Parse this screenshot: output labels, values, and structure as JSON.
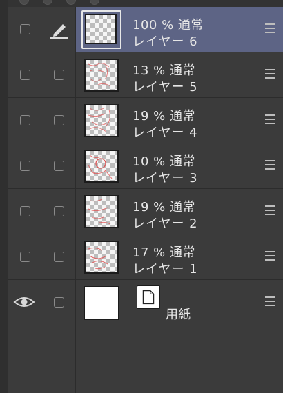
{
  "panel": {
    "layers": [
      {
        "opacity": "100 %",
        "blend": "通常",
        "name": "レイヤー 6",
        "active": true,
        "visible": false,
        "locked_icon": "pen-icon"
      },
      {
        "opacity": "13 %",
        "blend": "通常",
        "name": "レイヤー 5",
        "active": false,
        "visible": false
      },
      {
        "opacity": "19 %",
        "blend": "通常",
        "name": "レイヤー 4",
        "active": false,
        "visible": false
      },
      {
        "opacity": "10 %",
        "blend": "通常",
        "name": "レイヤー 3",
        "active": false,
        "visible": false
      },
      {
        "opacity": "19 %",
        "blend": "通常",
        "name": "レイヤー 2",
        "active": false,
        "visible": false
      },
      {
        "opacity": "17 %",
        "blend": "通常",
        "name": "レイヤー 1",
        "active": false,
        "visible": false
      }
    ],
    "paper": {
      "name": "用紙",
      "visible": true
    }
  },
  "colors": {
    "panel_bg": "#3b3b3b",
    "active_row": "#5d6485",
    "sketch_red": "#e05050"
  },
  "icons": [
    "pen-icon",
    "eye-icon",
    "menu-icon",
    "paper-icon",
    "checkbox"
  ]
}
